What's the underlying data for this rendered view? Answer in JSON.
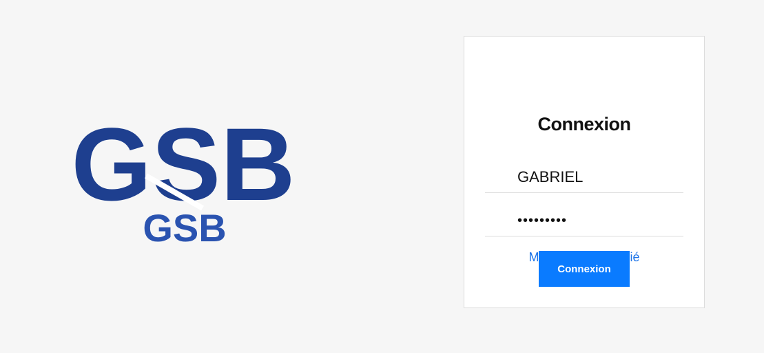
{
  "logo": {
    "big_text": "GSB",
    "small_text": "GSB",
    "brand_color": "#1e3f8f",
    "accent_color": "#2a53b0"
  },
  "login": {
    "title": "Connexion",
    "username_value": "GABRIEL",
    "password_value": "•••••••••",
    "forgot_label": "Mot de passe oublié",
    "submit_label": "Connexion",
    "link_color": "#1d74e8",
    "button_color": "#0a7bff"
  }
}
